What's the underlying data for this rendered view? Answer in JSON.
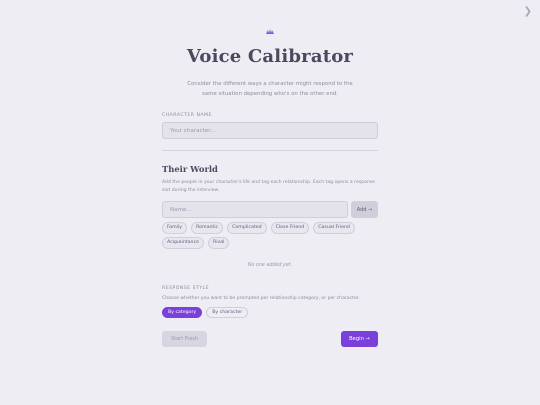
{
  "header": {
    "corner_icon": "chevron-right-icon",
    "logo_icon": "quill-icon",
    "accent_color": "#7b3fdc",
    "title": "Voice Calibrator",
    "subtitle": "Consider the different ways a character might respond to the same situation depending who's on the other end."
  },
  "character": {
    "label": "CHARACTER NAME",
    "placeholder": "Your character..."
  },
  "world": {
    "title": "Their World",
    "description": "Add the people in your character's life and tag each relationship. Each tag opens a response slot during the interview.",
    "name_placeholder": "Name...",
    "add_label": "Add →",
    "tags": [
      "Family",
      "Romantic",
      "Complicated",
      "Close Friend",
      "Casual Friend",
      "Acquaintance",
      "Rival"
    ],
    "empty_note": "No one added yet."
  },
  "response_style": {
    "label": "RESPONSE STYLE",
    "description": "Choose whether you want to be prompted per relationship category, or per character.",
    "options": [
      "By category",
      "By character"
    ],
    "selected": "By category"
  },
  "actions": {
    "start_fresh": "Start Fresh",
    "begin": "Begin →"
  }
}
